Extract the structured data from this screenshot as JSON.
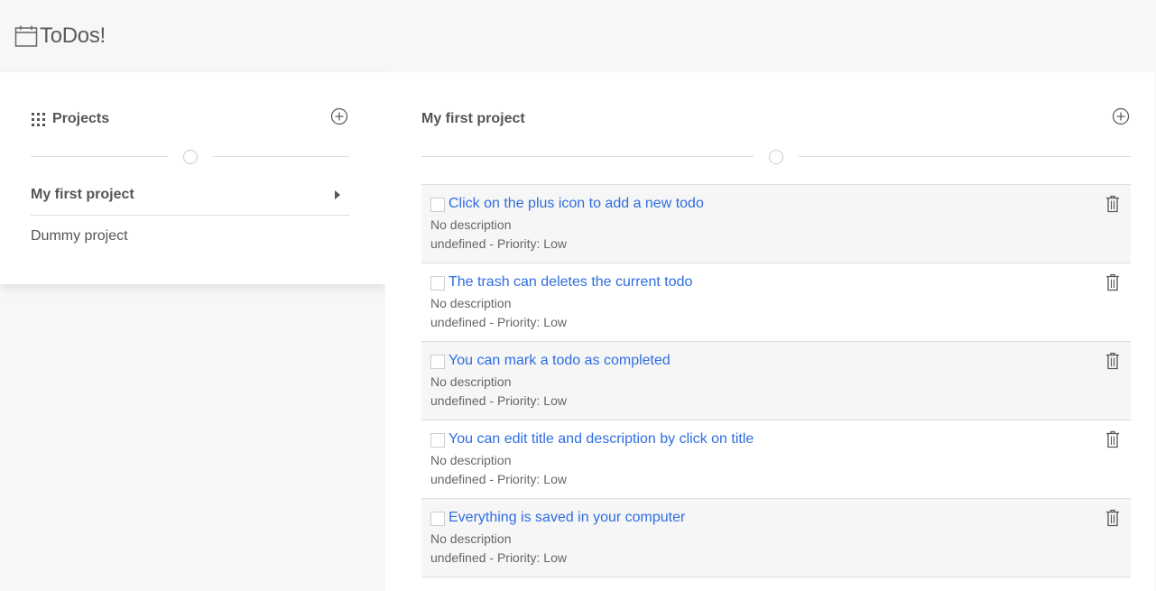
{
  "app": {
    "title": "ToDos!",
    "icon": "calendar-icon"
  },
  "sidebar": {
    "title": "Projects",
    "title_icon": "grid-icon",
    "add_icon": "plus-circle-icon",
    "projects": [
      {
        "label": "My first project",
        "active": true
      },
      {
        "label": "Dummy project",
        "active": false
      }
    ]
  },
  "main": {
    "title": "My first project",
    "add_icon": "plus-circle-icon",
    "todos": [
      {
        "title": "Click on the plus icon to add a new todo",
        "description": "No description",
        "meta": "undefined - Priority: Low",
        "completed": false
      },
      {
        "title": "The trash can deletes the current todo",
        "description": "No description",
        "meta": "undefined - Priority: Low",
        "completed": false
      },
      {
        "title": "You can mark a todo as completed",
        "description": "No description",
        "meta": "undefined - Priority: Low",
        "completed": false
      },
      {
        "title": "You can edit title and description by click on title",
        "description": "No description",
        "meta": "undefined - Priority: Low",
        "completed": false
      },
      {
        "title": "Everything is saved in your computer",
        "description": "No description",
        "meta": "undefined - Priority: Low",
        "completed": false
      }
    ]
  },
  "colors": {
    "link": "#2f6de1",
    "text": "#555555",
    "header_bg": "#f7f7f7",
    "divider": "#dddddd"
  }
}
